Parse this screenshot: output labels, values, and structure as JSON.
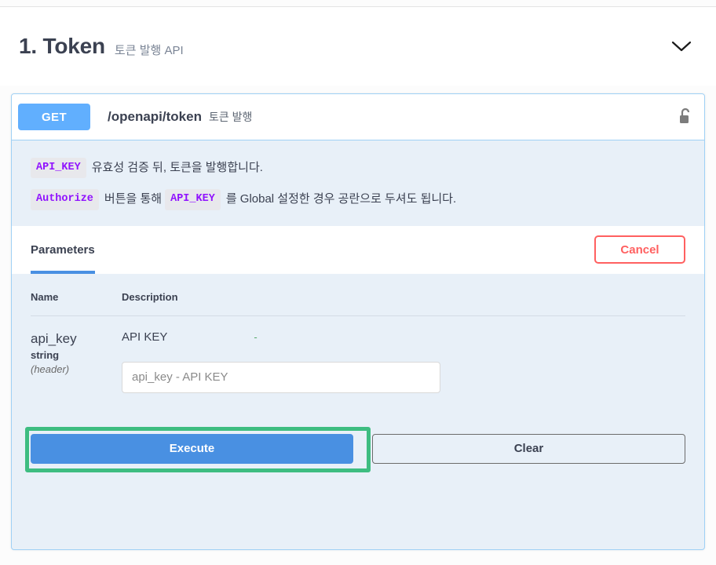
{
  "tag": {
    "title": "1. Token",
    "description": "토큰 발행 API",
    "collapse_icon": "chevron-down-icon"
  },
  "operation": {
    "method": "GET",
    "path": "/openapi/token",
    "summary": "토큰 발행",
    "auth_icon": "unlocked-padlock-icon",
    "description_lines": [
      {
        "badge": "API_KEY",
        "text": "유효성 검증 뒤, 토큰을 발행합니다.",
        "badge2": "",
        "text2": ""
      },
      {
        "badge": "Authorize",
        "text": "버튼을 통해",
        "badge2": "API_KEY",
        "text2": "를 Global 설정한 경우 공란으로 두셔도 됩니다."
      }
    ],
    "tabs": [
      {
        "label": "Parameters",
        "active": true
      }
    ],
    "cancel_label": "Cancel",
    "table": {
      "headers": [
        "Name",
        "Description"
      ],
      "rows": [
        {
          "name": "api_key",
          "type": "string",
          "in": "(header)",
          "description": "API KEY",
          "marker": "-",
          "input_value": "",
          "input_placeholder": "api_key - API KEY"
        }
      ]
    },
    "execute_label": "Execute",
    "clear_label": "Clear"
  },
  "colors": {
    "get_method": "#61affe",
    "execute_blue": "#4990e2",
    "cancel_red": "#ff6060",
    "badge_purple": "#9012fe",
    "highlight_green": "#3ebd81",
    "block_border": "#9fd0f5",
    "block_bg": "#e8f0f8"
  }
}
